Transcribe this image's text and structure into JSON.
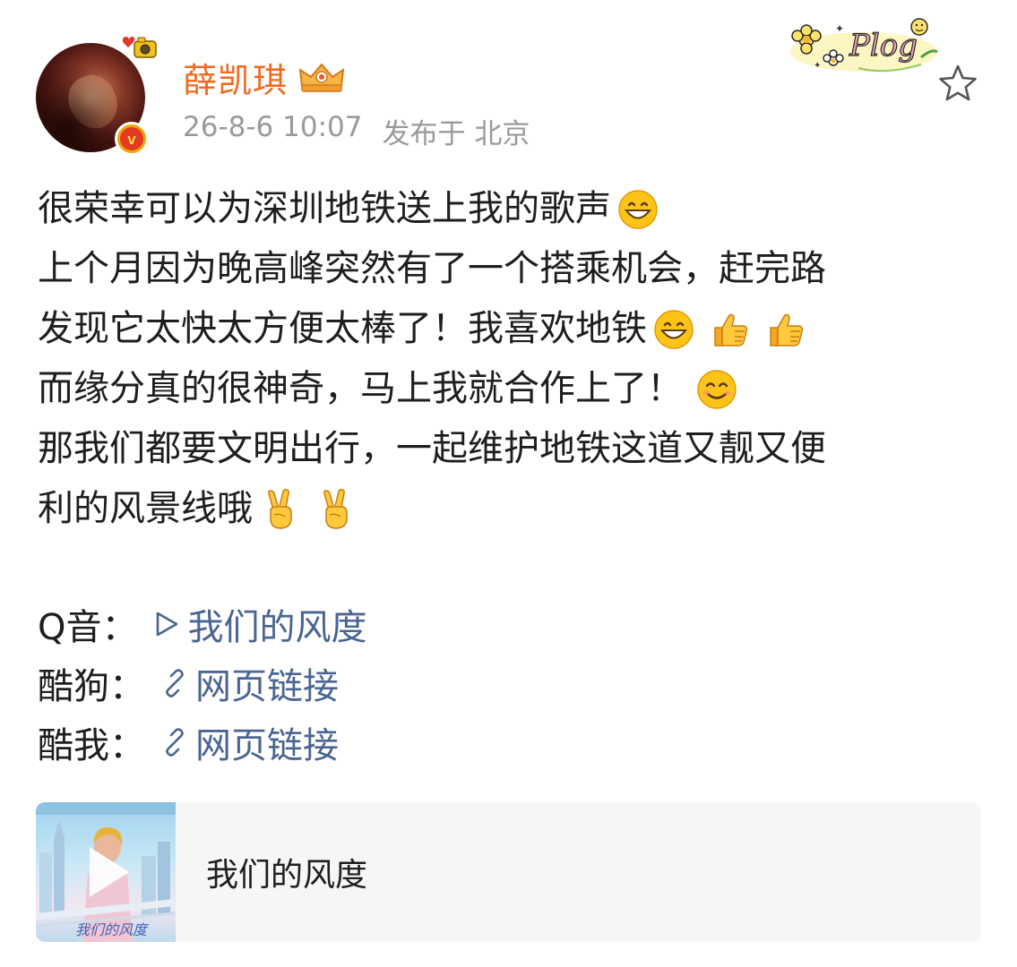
{
  "header": {
    "username": "薛凯琪",
    "timestamp": "26-8-6 10:07",
    "location": "发布于 北京",
    "badges": {
      "verified": "verified-gold-v",
      "vip": "crown-vip",
      "sticker": "Plog"
    }
  },
  "post": {
    "lines": [
      {
        "text": "很荣幸可以为深圳地铁送上我的歌声",
        "emojis": [
          "grin-emoji"
        ]
      },
      {
        "text": "上个月因为晚高峰突然有了一个搭乘机会，赶完路",
        "emojis": []
      },
      {
        "text": "发现它太快太方便太棒了！我喜欢地铁",
        "emojis": [
          "grin-emoji",
          "thumbs-up-emoji",
          "thumbs-up-emoji"
        ]
      },
      {
        "text": "而缘分真的很神奇，马上我就合作上了！",
        "emojis": [
          "smile-emoji"
        ]
      },
      {
        "text": "那我们都要文明出行，一起维护地铁这道又靓又便",
        "emojis": []
      },
      {
        "text": "利的风景线哦",
        "emojis": [
          "victory-hand-emoji",
          "victory-hand-emoji"
        ]
      }
    ]
  },
  "links": [
    {
      "prefix": "Q音：",
      "label": "我们的风度",
      "icon": "play-triangle-icon"
    },
    {
      "prefix": "酷狗：",
      "label": "网页链接",
      "icon": "link-icon"
    },
    {
      "prefix": "酷我：",
      "label": "网页链接",
      "icon": "link-icon"
    }
  ],
  "music_card": {
    "title": "我们的风度"
  },
  "colors": {
    "username": "#ef6a1e",
    "meta": "#9a9a9a",
    "link": "#4a6592",
    "card_bg": "#f6f6f6",
    "verified": "#f0a800"
  }
}
